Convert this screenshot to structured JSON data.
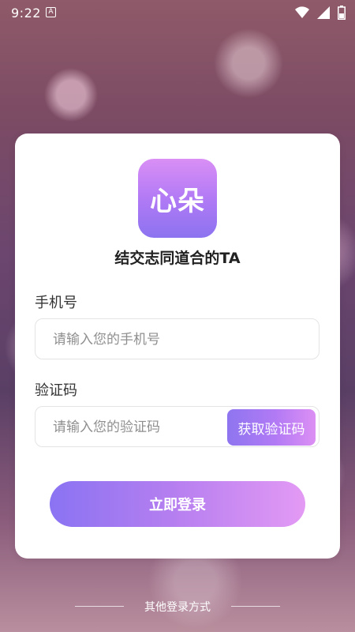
{
  "status_bar": {
    "time": "9:22",
    "notification_letter": "A",
    "icons": [
      "wifi-icon",
      "signal-icon",
      "battery-icon"
    ]
  },
  "logo": {
    "text": "心朵"
  },
  "tagline": "结交志同道合的TA",
  "phone_field": {
    "label": "手机号",
    "placeholder": "请输入您的手机号",
    "value": ""
  },
  "code_field": {
    "label": "验证码",
    "placeholder": "请输入您的验证码",
    "value": "",
    "get_code_button": "获取验证码"
  },
  "login_button": "立即登录",
  "other_login": "其他登录方式",
  "colors": {
    "accent_start": "#8a73f2",
    "accent_end": "#e39af4",
    "card_bg": "#ffffff"
  }
}
